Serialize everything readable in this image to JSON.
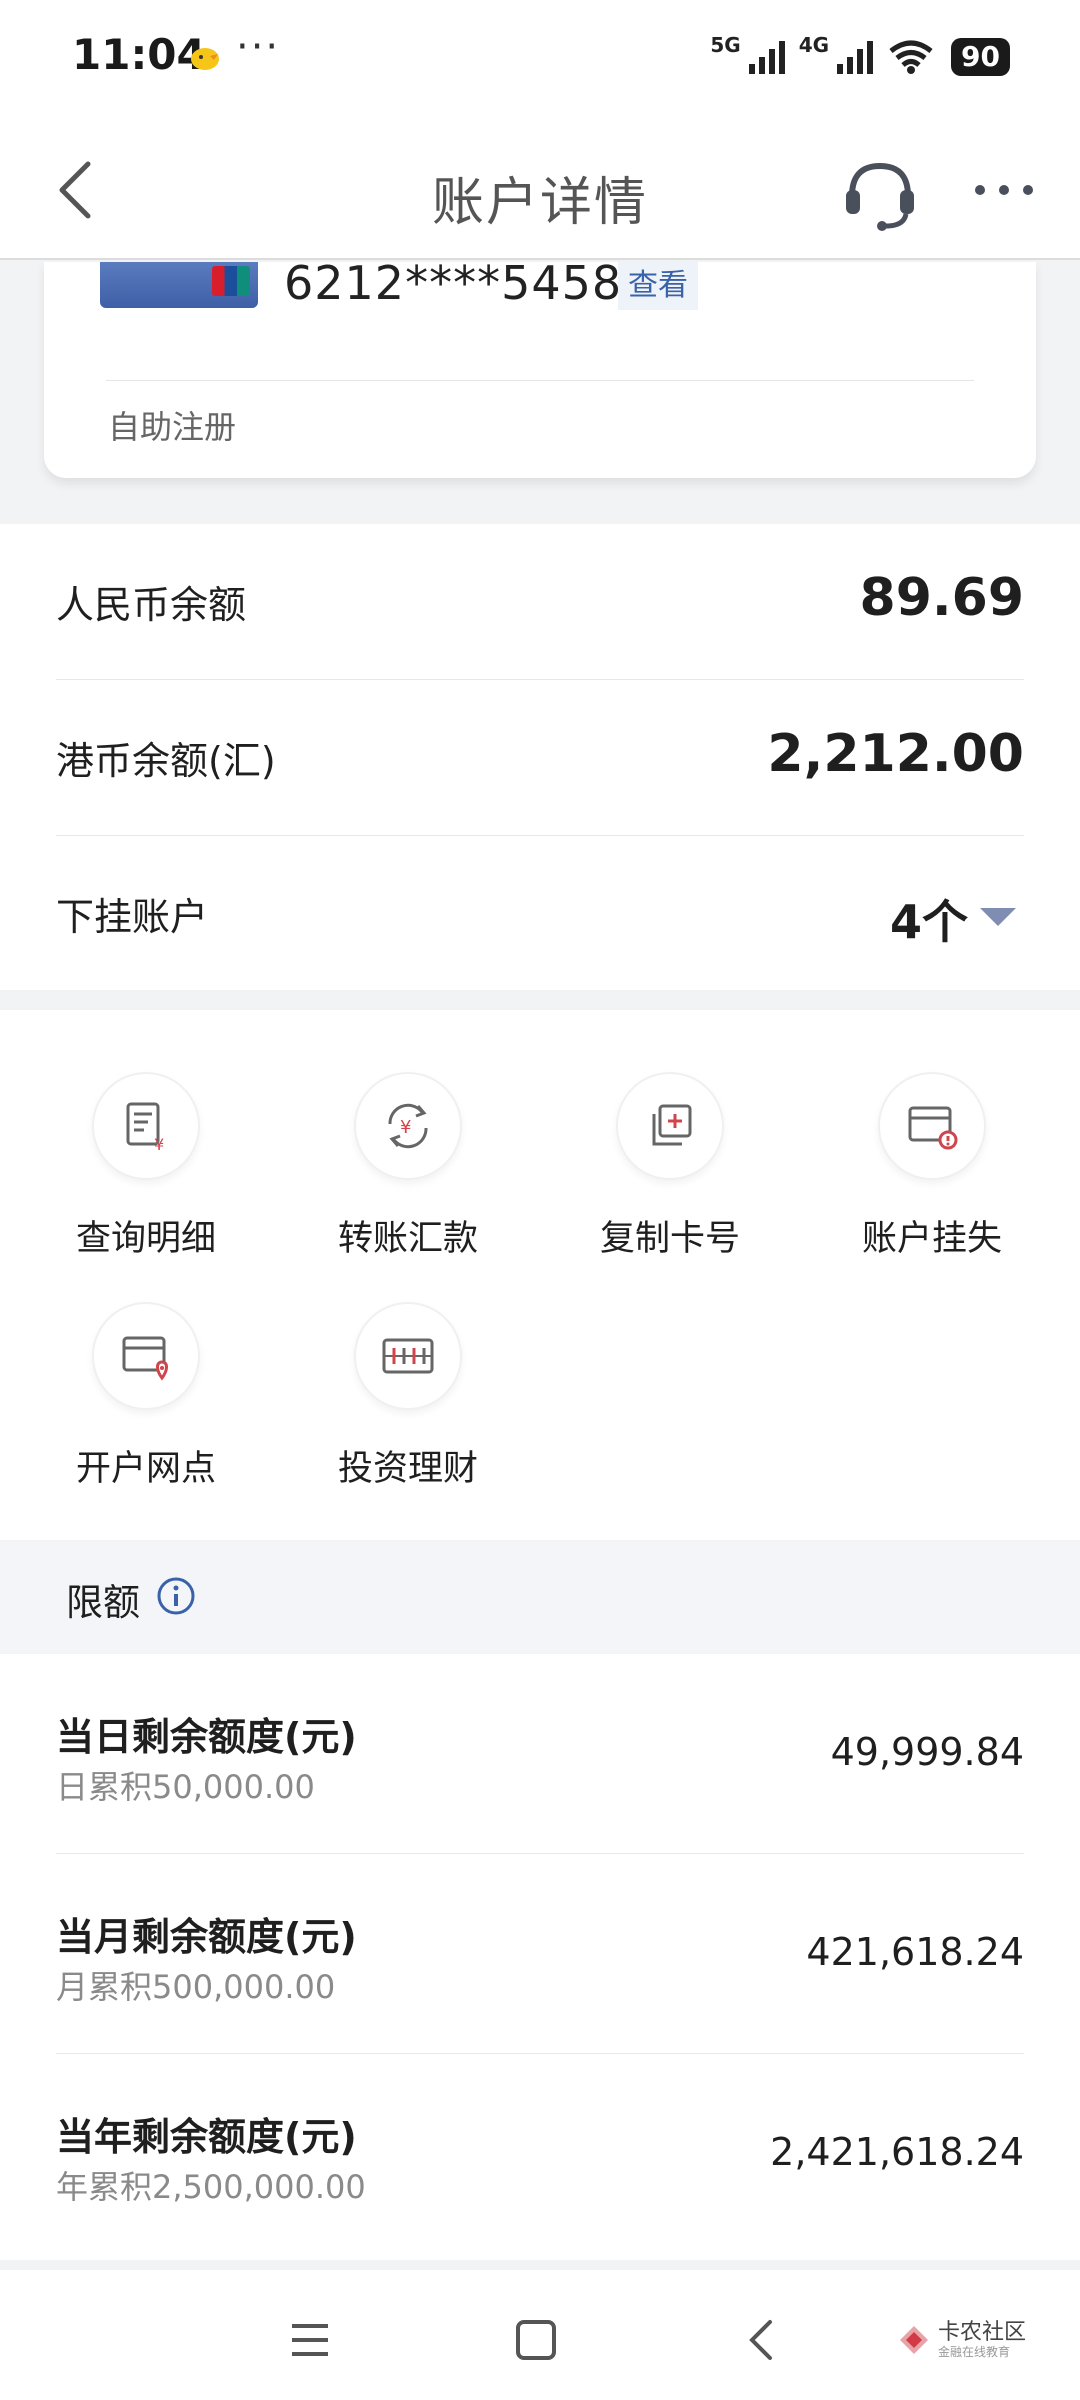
{
  "status_bar": {
    "time": "11:04",
    "dots": "···",
    "signal_1_label": "5G",
    "signal_2_label": "4G",
    "battery": "90"
  },
  "nav": {
    "title": "账户详情"
  },
  "card": {
    "number": "6212****5458",
    "view_label": "查看",
    "self_register": "自助注册"
  },
  "balances": [
    {
      "label": "人民币余额",
      "value": "89.69"
    },
    {
      "label": "港币余额(汇)",
      "value": "2,212.00"
    }
  ],
  "sub_accounts": {
    "label": "下挂账户",
    "value": "4个"
  },
  "actions": [
    {
      "label": "查询明细",
      "icon": "statement-icon"
    },
    {
      "label": "转账汇款",
      "icon": "transfer-icon"
    },
    {
      "label": "复制卡号",
      "icon": "copy-card-icon"
    },
    {
      "label": "账户挂失",
      "icon": "report-loss-icon"
    },
    {
      "label": "开户网点",
      "icon": "branch-location-icon"
    },
    {
      "label": "投资理财",
      "icon": "investment-icon"
    }
  ],
  "limits": {
    "title": "限额",
    "rows": [
      {
        "title": "当日剩余额度(元)",
        "sub": "日累积50,000.00",
        "value": "49,999.84"
      },
      {
        "title": "当月剩余额度(元)",
        "sub": "月累积500,000.00",
        "value": "421,618.24"
      },
      {
        "title": "当年剩余额度(元)",
        "sub": "年累积2,500,000.00",
        "value": "2,421,618.24"
      }
    ]
  },
  "watermark": {
    "main": "卡农社区",
    "sub": "金融在线教育"
  },
  "colors": {
    "accent_blue": "#3a62a8",
    "icon_red": "#d0454c",
    "icon_gray": "#666666"
  }
}
